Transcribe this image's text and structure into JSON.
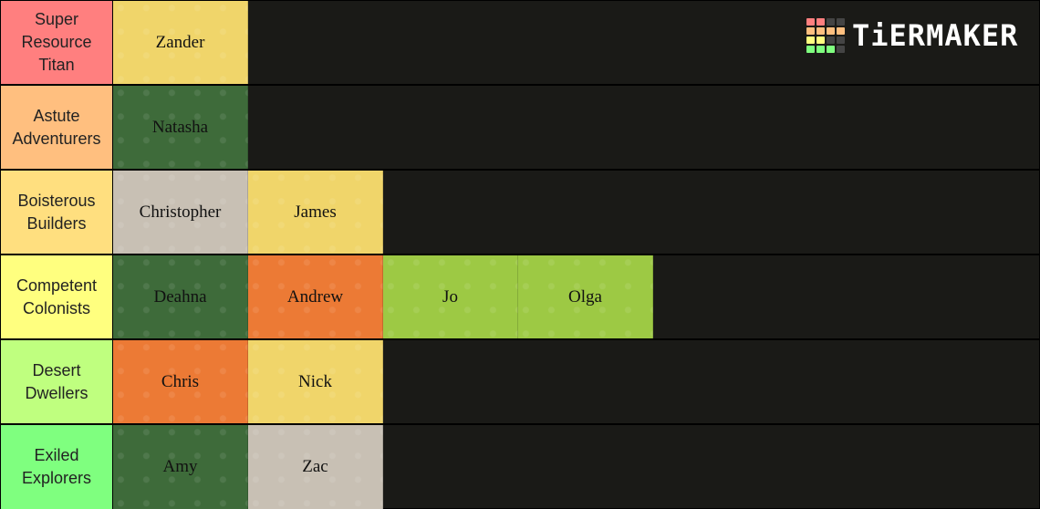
{
  "logo": {
    "text": "TiERMAKER",
    "grid_colors": [
      "#ff7f7f",
      "#ff7f7f",
      "#444444",
      "#444444",
      "#ffbf7f",
      "#ffbf7f",
      "#ffbf7f",
      "#ffbf7f",
      "#ffff7f",
      "#ffff7f",
      "#444444",
      "#444444",
      "#7fff7f",
      "#7fff7f",
      "#7fff7f",
      "#444444"
    ]
  },
  "tiers": [
    {
      "label": "Super Resource Titan",
      "color": "#ff7f7f",
      "items": [
        {
          "name": "Zander",
          "color": "#f0d56a"
        }
      ]
    },
    {
      "label": "Astute Adventurers",
      "color": "#ffbf7f",
      "items": [
        {
          "name": "Natasha",
          "color": "#3e6b3a"
        }
      ]
    },
    {
      "label": "Boisterous Builders",
      "color": "#ffdf7f",
      "items": [
        {
          "name": "Christopher",
          "color": "#c8c0b4"
        },
        {
          "name": "James",
          "color": "#f0d56a"
        }
      ]
    },
    {
      "label": "Competent Colonists",
      "color": "#ffff7f",
      "items": [
        {
          "name": "Deahna",
          "color": "#3e6b3a"
        },
        {
          "name": "Andrew",
          "color": "#ec7a35"
        },
        {
          "name": "Jo",
          "color": "#9dc944"
        },
        {
          "name": "Olga",
          "color": "#9dc944"
        }
      ]
    },
    {
      "label": "Desert Dwellers",
      "color": "#bfff7f",
      "items": [
        {
          "name": "Chris",
          "color": "#ec7a35"
        },
        {
          "name": "Nick",
          "color": "#f0d56a"
        }
      ]
    },
    {
      "label": "Exiled Explorers",
      "color": "#7fff7f",
      "items": [
        {
          "name": "Amy",
          "color": "#3e6b3a"
        },
        {
          "name": "Zac",
          "color": "#c8c0b4"
        }
      ]
    }
  ]
}
